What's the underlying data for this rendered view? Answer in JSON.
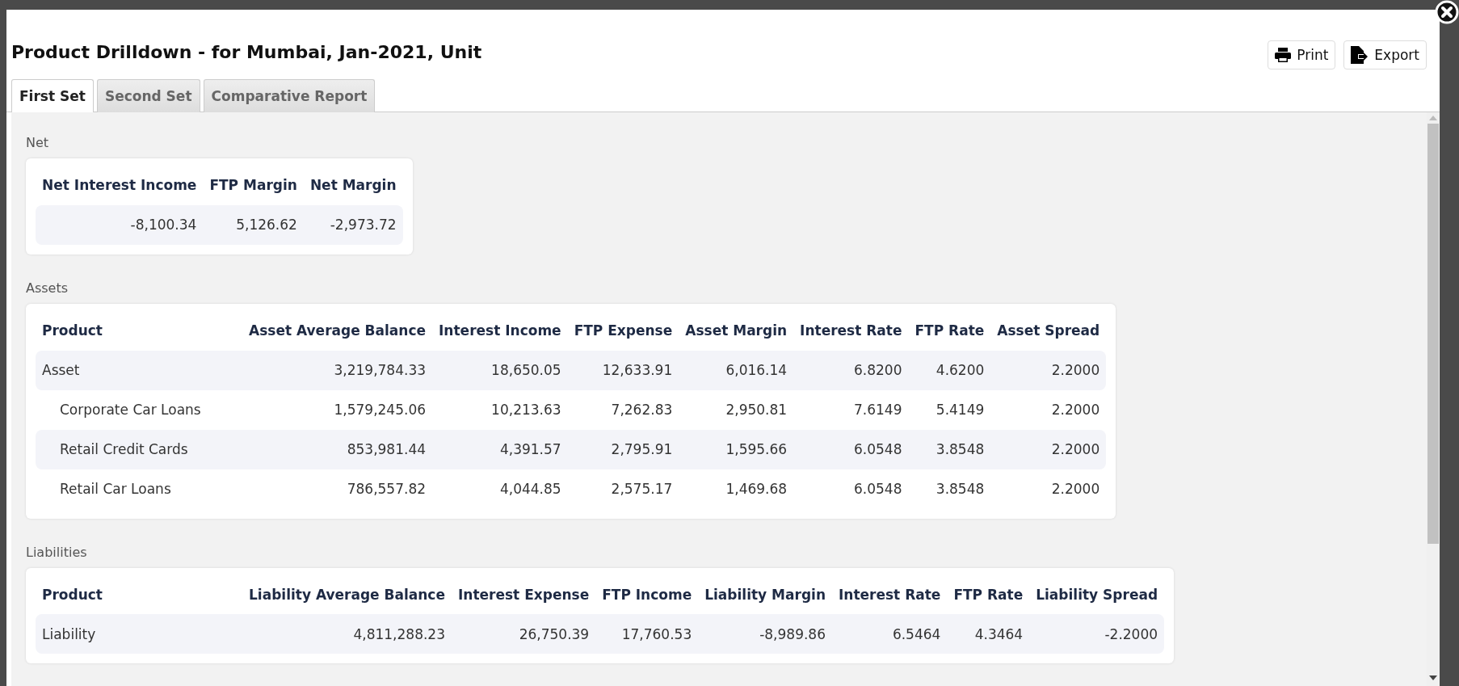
{
  "dialog": {
    "title": "Product Drilldown - for Mumbai, Jan-2021, Unit",
    "buttons": [
      {
        "kind": "print",
        "label": "Print"
      },
      {
        "kind": "export",
        "label": "Export"
      }
    ]
  },
  "tabs": [
    {
      "label": "First Set",
      "selected": true
    },
    {
      "label": "Second Set",
      "selected": false
    },
    {
      "label": "Comparative Report",
      "selected": false
    }
  ],
  "sections": [
    {
      "heading": "Net",
      "columns": [
        "Net Interest Income",
        "FTP Margin",
        "Net Margin"
      ],
      "rows": [
        {
          "cells": [
            "-8,100.34",
            "5,126.62",
            "-2,973.72"
          ]
        }
      ]
    },
    {
      "heading": "Assets",
      "columns": [
        "Product",
        "Asset Average Balance",
        "Interest Income",
        "FTP Expense",
        "Asset Margin",
        "Interest Rate",
        "FTP Rate",
        "Asset Spread"
      ],
      "rows": [
        {
          "cells": [
            "Asset",
            "3,219,784.33",
            "18,650.05",
            "12,633.91",
            "6,016.14",
            "6.8200",
            "4.6200",
            "2.2000"
          ],
          "children": [
            {
              "cells": [
                "Corporate Car Loans",
                "1,579,245.06",
                "10,213.63",
                "7,262.83",
                "2,950.81",
                "7.6149",
                "5.4149",
                "2.2000"
              ]
            },
            {
              "cells": [
                "Retail Credit Cards",
                "853,981.44",
                "4,391.57",
                "2,795.91",
                "1,595.66",
                "6.0548",
                "3.8548",
                "2.2000"
              ]
            },
            {
              "cells": [
                "Retail Car Loans",
                "786,557.82",
                "4,044.85",
                "2,575.17",
                "1,469.68",
                "6.0548",
                "3.8548",
                "2.2000"
              ]
            }
          ]
        }
      ]
    },
    {
      "heading": "Liabilities",
      "columns": [
        "Product",
        "Liability Average Balance",
        "Interest Expense",
        "FTP Income",
        "Liability Margin",
        "Interest Rate",
        "FTP Rate",
        "Liability Spread"
      ],
      "rows": [
        {
          "cells": [
            "Liability",
            "4,811,288.23",
            "26,750.39",
            "17,760.53",
            "-8,989.86",
            "6.5464",
            "4.3464",
            "-2.2000"
          ]
        }
      ]
    }
  ]
}
